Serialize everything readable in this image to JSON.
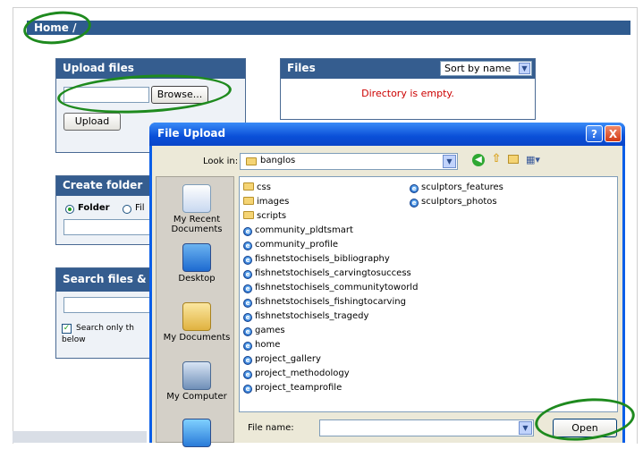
{
  "breadcrumb": {
    "label": "Home /"
  },
  "upload_panel": {
    "title": "Upload files",
    "browse_label": "Browse...",
    "upload_label": "Upload"
  },
  "files_panel": {
    "title": "Files",
    "sort_value": "Sort by name",
    "empty_message": "Directory is empty."
  },
  "create_folder_panel": {
    "title": "Create folder",
    "folder_option": "Folder",
    "file_option": "Fil"
  },
  "search_panel": {
    "title": "Search files & fo",
    "checkbox_label_line1": "Search only th",
    "checkbox_label_line2": "below"
  },
  "dialog": {
    "title": "File Upload",
    "help_button": "?",
    "close_button": "X",
    "look_in_label": "Look in:",
    "look_in_value": "banglos",
    "places": [
      {
        "label": "My Recent Documents",
        "icon": "recent-documents-icon"
      },
      {
        "label": "Desktop",
        "icon": "desktop-icon"
      },
      {
        "label": "My Documents",
        "icon": "my-documents-icon"
      },
      {
        "label": "My Computer",
        "icon": "my-computer-icon"
      },
      {
        "label": "",
        "icon": "network-places-icon"
      }
    ],
    "files_col1": [
      {
        "name": "css",
        "type": "folder"
      },
      {
        "name": "images",
        "type": "folder"
      },
      {
        "name": "scripts",
        "type": "folder"
      },
      {
        "name": "community_pldtsmart",
        "type": "html"
      },
      {
        "name": "community_profile",
        "type": "html"
      },
      {
        "name": "fishnetstochisels_bibliography",
        "type": "html"
      },
      {
        "name": "fishnetstochisels_carvingtosuccess",
        "type": "html"
      },
      {
        "name": "fishnetstochisels_communitytoworld",
        "type": "html"
      },
      {
        "name": "fishnetstochisels_fishingtocarving",
        "type": "html"
      },
      {
        "name": "fishnetstochisels_tragedy",
        "type": "html"
      },
      {
        "name": "games",
        "type": "html"
      },
      {
        "name": "home",
        "type": "html"
      },
      {
        "name": "project_gallery",
        "type": "html"
      },
      {
        "name": "project_methodology",
        "type": "html"
      },
      {
        "name": "project_teamprofile",
        "type": "html"
      }
    ],
    "files_col2": [
      {
        "name": "sculptors_features",
        "type": "html"
      },
      {
        "name": "sculptors_photos",
        "type": "html"
      }
    ],
    "file_name_label": "File name:",
    "file_name_value": "",
    "open_label": "Open"
  },
  "colors": {
    "header_blue": "#2f5b8f",
    "dialog_title_blue": "#0a5ee8",
    "annotation_green": "#1e8a1e",
    "empty_red": "#cc0000"
  }
}
